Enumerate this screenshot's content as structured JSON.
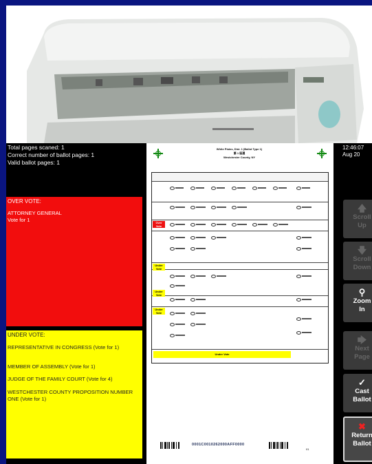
{
  "stats": {
    "total": "Total pages scaned: 1",
    "correct": "Correct number of ballot pages: 1",
    "valid": "Valid ballot pages: 1"
  },
  "over_vote": {
    "heading": "OVER VOTE:",
    "items": [
      "ATTORNEY GENERAL\nVote for 1"
    ]
  },
  "under_vote": {
    "heading": "UNDER VOTE:",
    "items": [
      "REPRESENTATIVE IN CONGRESS (Vote for 1)",
      "MEMBER OF ASSEMBLY (Vote for 1)",
      "JUDGE OF THE FAMILY COURT (Vote for 4)",
      "WESTCHESTER COUNTY PROPOSITION NUMBER ONE (Vote for 1)"
    ]
  },
  "ballot": {
    "title": "White Plains, Dist. 1 (Ballot Type 1)",
    "line2": "第 1 區選",
    "line3": "Westchester County, NY",
    "over_vote_label": "Over Vote",
    "under_vote_label": "Under Vote",
    "under_vote_footer": "Under Vote",
    "barcode_text": "0001C0010262000AFF0000",
    "page_number": "01"
  },
  "clock": {
    "time": "12:46:07",
    "date": "Aug 20"
  },
  "buttons": {
    "scroll_up": {
      "line1": "Scroll",
      "line2": "Up",
      "icon": "arrow-up-icon"
    },
    "scroll_down": {
      "line1": "Scroll",
      "line2": "Down",
      "icon": "arrow-down-icon"
    },
    "zoom_in": {
      "line1": "Zoom",
      "line2": "In",
      "icon": "magnifier-icon"
    },
    "next_page": {
      "line1": "Next",
      "line2": "Page",
      "icon": "arrow-right-icon"
    },
    "cast_ballot": {
      "line1": "Cast",
      "line2": "Ballot",
      "icon": "checkmark-icon"
    },
    "return_ballot": {
      "line1": "Return",
      "line2": "Ballot",
      "icon": "x-icon"
    }
  },
  "colors": {
    "background": "#0a1580",
    "over_vote": "#f20d0d",
    "under_vote": "#ffff00",
    "button": "#3a3a3a"
  }
}
